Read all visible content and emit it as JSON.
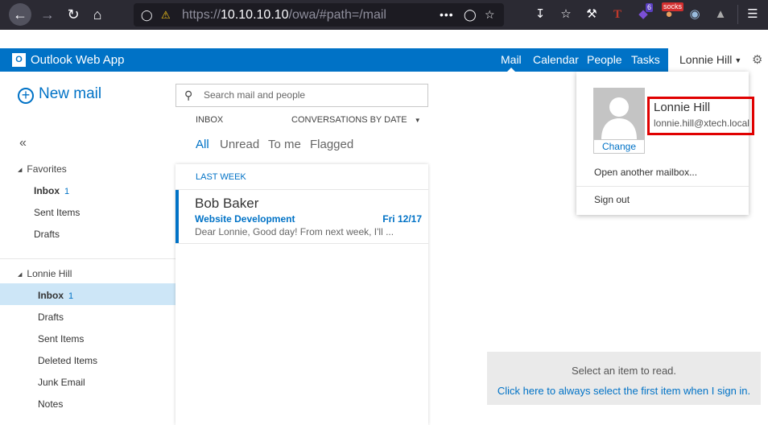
{
  "browser": {
    "url_scheme": "https://",
    "url_host": "10.10.10.10",
    "url_path": "/owa/#path=/mail",
    "tab_badge_count": "6",
    "socks_label": "socks"
  },
  "header": {
    "app_title": "Outlook Web App",
    "logo_letter": "O",
    "nav": [
      "Mail",
      "Calendar",
      "People",
      "Tasks"
    ],
    "user_name": "Lonnie Hill"
  },
  "left_nav": {
    "new_mail": "New mail",
    "collapse_glyph": "«",
    "favorites_label": "Favorites",
    "favorites": [
      {
        "name": "Inbox",
        "count": "1"
      },
      {
        "name": "Sent Items",
        "count": ""
      },
      {
        "name": "Drafts",
        "count": ""
      }
    ],
    "account_label": "Lonnie Hill",
    "folders": [
      {
        "name": "Inbox",
        "count": "1"
      },
      {
        "name": "Drafts",
        "count": ""
      },
      {
        "name": "Sent Items",
        "count": ""
      },
      {
        "name": "Deleted Items",
        "count": ""
      },
      {
        "name": "Junk Email",
        "count": ""
      },
      {
        "name": "Notes",
        "count": ""
      }
    ]
  },
  "message_list": {
    "search_placeholder": "Search mail and people",
    "folder_label": "INBOX",
    "sort_label": "CONVERSATIONS BY DATE",
    "filters": [
      "All",
      "Unread",
      "To me",
      "Flagged"
    ],
    "group_label": "LAST WEEK",
    "messages": [
      {
        "from": "Bob Baker",
        "subject": "Website Development",
        "date": "Fri 12/17",
        "preview": "Dear Lonnie, Good day! From next week, I'll ..."
      }
    ]
  },
  "reading_pane": {
    "empty_text": "Select an item to read.",
    "link_text": "Click here to always select the first item when I sign in."
  },
  "user_flyout": {
    "name": "Lonnie Hill",
    "email": "lonnie.hill@xtech.local",
    "change_label": "Change",
    "open_mailbox": "Open another mailbox...",
    "sign_out": "Sign out"
  },
  "colors": {
    "brand": "#0072c6",
    "highlight": "#e00000",
    "selected_folder": "#cde6f7"
  }
}
